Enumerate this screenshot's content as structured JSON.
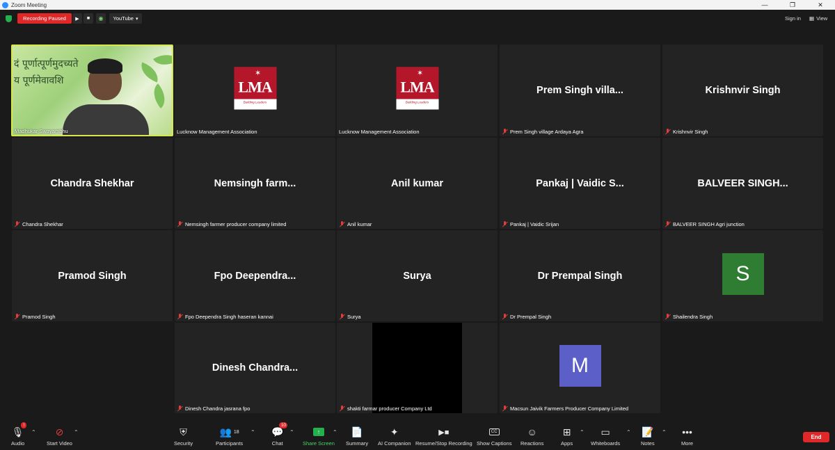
{
  "window": {
    "title": "Zoom Meeting"
  },
  "topbar": {
    "recording_status": "Recording Paused",
    "play_icon": "▶",
    "stop_icon": "■",
    "stream_icon": "⟟",
    "youtube_label": "YouTube",
    "youtube_caret": "▾",
    "sign_in": "Sign in",
    "view": "View"
  },
  "video_tile": {
    "name": "Madhukar Swayambhu",
    "overlay_line1": "दं पूर्णात्पूर्णमुदच्यते",
    "overlay_line2": "य पूर्णमेवावशि"
  },
  "tiles": [
    {
      "label": "Lucknow Management Association",
      "type": "logo"
    },
    {
      "label": "Lucknow Management Association",
      "type": "logo"
    },
    {
      "display": "Prem Singh villa...",
      "label": "Prem Singh village Ardaya Agra"
    },
    {
      "display": "Krishnvir Singh",
      "label": "Krishnvir Singh"
    },
    {
      "display": "Chandra Shekhar",
      "label": "Chandra Shekhar"
    },
    {
      "display": "Nemsingh  farm...",
      "label": "Nemsingh farmer producer company limited"
    },
    {
      "display": "Anil kumar",
      "label": "Anil kumar"
    },
    {
      "display": "Pankaj | Vaidic S...",
      "label": "Pankaj | Vaidic Srijan"
    },
    {
      "display": "BALVEER  SINGH...",
      "label": "BALVEER SINGH Agri junction"
    },
    {
      "display": "Pramod Singh",
      "label": "Pramod Singh"
    },
    {
      "display": "Fpo  Deependra...",
      "label": "Fpo Deependra Singh haseran kannai"
    },
    {
      "display": "Surya",
      "label": "Surya"
    },
    {
      "display": "Dr Prempal Singh",
      "label": "Dr Prempal Singh"
    },
    {
      "initial": "S",
      "label": "Shailendra Singh",
      "avatar_color": "#2e7d32"
    },
    {
      "display": "Dinesh  Chandra...",
      "label": "Dinesh Chandra jasrana fpo"
    },
    {
      "label": "shakti farmar producer Company Ltd",
      "type": "black"
    },
    {
      "initial": "M",
      "label": "Macsun Jaivik Farmers Producer Company Limited",
      "avatar_color": "#5b5fc7"
    }
  ],
  "logo": {
    "text": "LMA",
    "tagline": "Building Leaders"
  },
  "toolbar": {
    "audio": "Audio",
    "start_video": "Start Video",
    "security": "Security",
    "participants": "Participants",
    "participants_count": "18",
    "chat": "Chat",
    "chat_badge": "10",
    "share_screen": "Share Screen",
    "summary": "Summary",
    "ai_companion": "AI Companion",
    "resume_stop_recording": "Resume/Stop Recording",
    "show_captions": "Show Captions",
    "cc_text": "CC",
    "reactions": "Reactions",
    "apps": "Apps",
    "whiteboards": "Whiteboards",
    "notes": "Notes",
    "more": "More",
    "end": "End"
  },
  "colors": {
    "accent_green": "#22b14c",
    "record_red": "#e02828",
    "active_speaker": "#d8e84a",
    "tile_bg": "#232323"
  }
}
